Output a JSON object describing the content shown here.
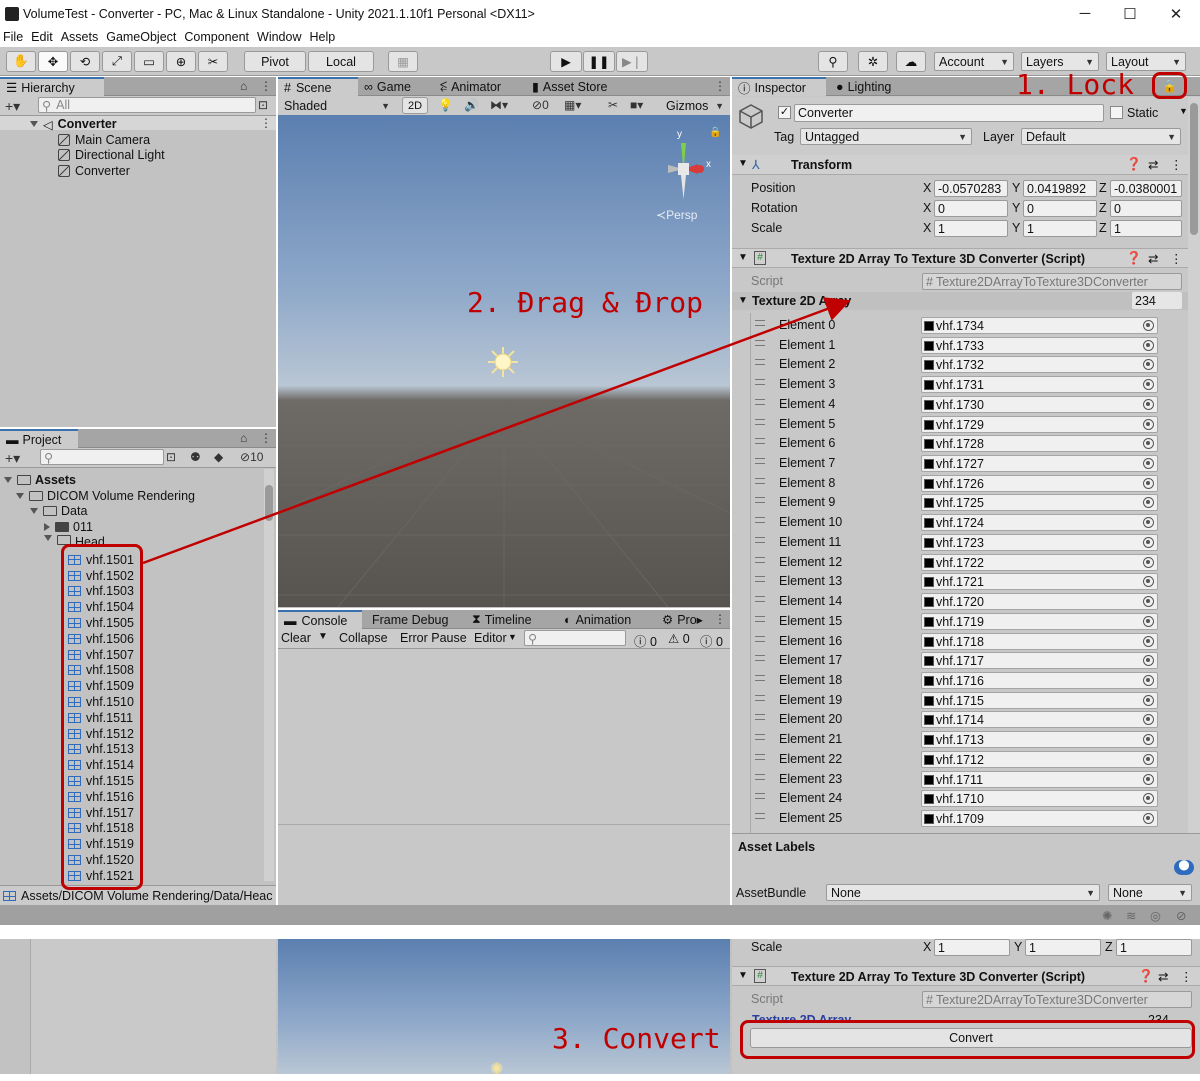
{
  "window": {
    "title": "VolumeTest - Converter - PC, Mac & Linux Standalone - Unity 2021.1.10f1 Personal <DX11>",
    "minimize": "─",
    "maximize": "☐",
    "close": "✕"
  },
  "menu": [
    "File",
    "Edit",
    "Assets",
    "GameObject",
    "Component",
    "Window",
    "Help"
  ],
  "toolbar": {
    "pivot": "Pivot",
    "local": "Local",
    "account": "Account",
    "layers": "Layers",
    "layout": "Layout"
  },
  "hierarchy": {
    "tab": "Hierarchy",
    "search_placeholder": "All",
    "root": "Converter",
    "children": [
      "Main Camera",
      "Directional Light",
      "Converter"
    ]
  },
  "project": {
    "tab": "Project",
    "hidden_count": "10",
    "tree": [
      "Assets",
      "DICOM Volume Rendering",
      "Data",
      "011",
      "Head"
    ],
    "assets": [
      "vhf.1501",
      "vhf.1502",
      "vhf.1503",
      "vhf.1504",
      "vhf.1505",
      "vhf.1506",
      "vhf.1507",
      "vhf.1508",
      "vhf.1509",
      "vhf.1510",
      "vhf.1511",
      "vhf.1512",
      "vhf.1513",
      "vhf.1514",
      "vhf.1515",
      "vhf.1516",
      "vhf.1517",
      "vhf.1518",
      "vhf.1519",
      "vhf.1520",
      "vhf.1521"
    ],
    "path": "Assets/DICOM Volume Rendering/Data/Heac"
  },
  "scene": {
    "tabs": [
      "Scene",
      "Game",
      "Animator",
      "Asset Store"
    ],
    "shading": "Shaded",
    "mode2d": "2D",
    "hidden": "0",
    "gizmos": "Gizmos",
    "persp": "Persp",
    "axis_x": "x",
    "axis_y": "y"
  },
  "console": {
    "tabs": [
      "Console",
      "Frame Debug",
      "Timeline",
      "Animation",
      "Pro"
    ],
    "clear": "Clear",
    "collapse": "Collapse",
    "error_pause": "Error Pause",
    "editor": "Editor",
    "counts": [
      "0",
      "0",
      "0"
    ]
  },
  "inspector": {
    "tabs": [
      "Inspector",
      "Lighting"
    ],
    "object_name": "Converter",
    "static_label": "Static",
    "tag_label": "Tag",
    "tag_value": "Untagged",
    "layer_label": "Layer",
    "layer_value": "Default",
    "transform": {
      "title": "Transform",
      "rows": [
        {
          "label": "Position",
          "x": "-0.0570283",
          "y": "0.0419892",
          "z": "-0.0380001"
        },
        {
          "label": "Rotation",
          "x": "0",
          "y": "0",
          "z": "0"
        },
        {
          "label": "Scale",
          "x": "1",
          "y": "1",
          "z": "1"
        }
      ]
    },
    "script_component": {
      "title": "Texture 2D Array To Texture 3D Converter (Script)",
      "script_label": "Script",
      "script_value": "Texture2DArrayToTexture3DConverter",
      "array_label": "Texture 2D Array",
      "array_size": "234"
    },
    "elements": [
      {
        "name": "Element 0",
        "value": "vhf.1734"
      },
      {
        "name": "Element 1",
        "value": "vhf.1733"
      },
      {
        "name": "Element 2",
        "value": "vhf.1732"
      },
      {
        "name": "Element 3",
        "value": "vhf.1731"
      },
      {
        "name": "Element 4",
        "value": "vhf.1730"
      },
      {
        "name": "Element 5",
        "value": "vhf.1729"
      },
      {
        "name": "Element 6",
        "value": "vhf.1728"
      },
      {
        "name": "Element 7",
        "value": "vhf.1727"
      },
      {
        "name": "Element 8",
        "value": "vhf.1726"
      },
      {
        "name": "Element 9",
        "value": "vhf.1725"
      },
      {
        "name": "Element 10",
        "value": "vhf.1724"
      },
      {
        "name": "Element 11",
        "value": "vhf.1723"
      },
      {
        "name": "Element 12",
        "value": "vhf.1722"
      },
      {
        "name": "Element 13",
        "value": "vhf.1721"
      },
      {
        "name": "Element 14",
        "value": "vhf.1720"
      },
      {
        "name": "Element 15",
        "value": "vhf.1719"
      },
      {
        "name": "Element 16",
        "value": "vhf.1718"
      },
      {
        "name": "Element 17",
        "value": "vhf.1717"
      },
      {
        "name": "Element 18",
        "value": "vhf.1716"
      },
      {
        "name": "Element 19",
        "value": "vhf.1715"
      },
      {
        "name": "Element 20",
        "value": "vhf.1714"
      },
      {
        "name": "Element 21",
        "value": "vhf.1713"
      },
      {
        "name": "Element 22",
        "value": "vhf.1712"
      },
      {
        "name": "Element 23",
        "value": "vhf.1711"
      },
      {
        "name": "Element 24",
        "value": "vhf.1710"
      },
      {
        "name": "Element 25",
        "value": "vhf.1709"
      }
    ],
    "asset_labels": "Asset Labels",
    "assetbundle_label": "AssetBundle",
    "assetbundle_value": "None",
    "assetbundle_variant": "None"
  },
  "bottom": {
    "scale_label": "Scale",
    "scale_x": "1",
    "scale_y": "1",
    "scale_z": "1",
    "script_title": "Texture 2D Array To Texture 3D Converter (Script)",
    "script_label": "Script",
    "script_value": "Texture2DArrayToTexture3DConverter",
    "array_label": "Texture 2D Array",
    "array_size": "234",
    "convert": "Convert"
  },
  "annotations": {
    "lock": "1. Lock",
    "drag": "2. Đrag & Đrop",
    "convert": "3. Convert"
  },
  "colors": {
    "annotation": "#c00000",
    "accent": "#3a72b0"
  }
}
